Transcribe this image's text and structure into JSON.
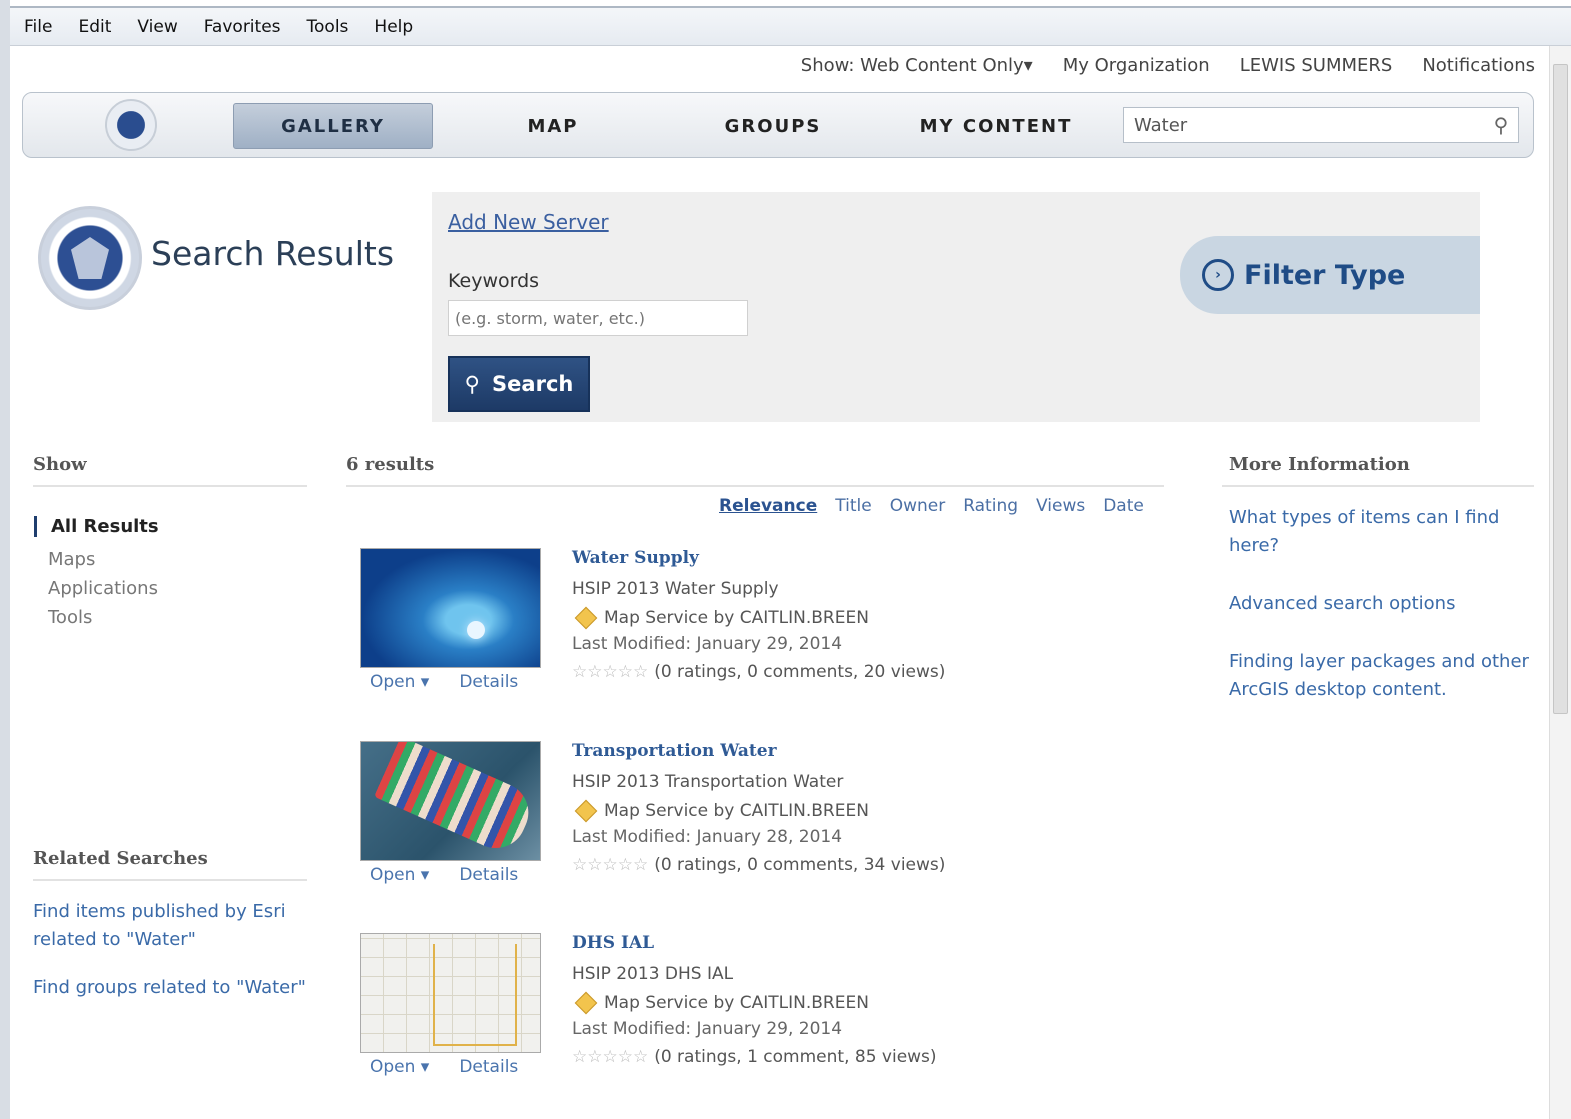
{
  "menu": [
    "File",
    "Edit",
    "View",
    "Favorites",
    "Tools",
    "Help"
  ],
  "toplinks": {
    "show": "Show: Web Content Only▾",
    "org": "My Organization",
    "user": "LEWIS SUMMERS",
    "notifications": "Notifications"
  },
  "nav": {
    "items": [
      "GALLERY",
      "MAP",
      "GROUPS",
      "MY CONTENT"
    ],
    "active": "GALLERY",
    "search_value": "Water"
  },
  "header": {
    "title": "Search Results",
    "add_server": "Add New Server",
    "keywords_label": "Keywords",
    "keywords_placeholder": "(e.g. storm, water, etc.)",
    "search_button": "Search",
    "filter_type": "Filter Type"
  },
  "left": {
    "show_heading": "Show",
    "show_items": [
      "All Results",
      "Maps",
      "Applications",
      "Tools"
    ],
    "related_heading": "Related Searches",
    "related_links": [
      "Find items published by Esri related to \"Water\"",
      "Find groups related to \"Water\""
    ]
  },
  "main": {
    "count": "6 results",
    "sort": [
      "Relevance",
      "Title",
      "Owner",
      "Rating",
      "Views",
      "Date"
    ],
    "open_label": "Open ▾",
    "details_label": "Details",
    "results": [
      {
        "title": "Water Supply",
        "desc": "HSIP 2013 Water Supply",
        "type": "Map Service by CAITLIN.BREEN",
        "modified": "Last Modified: January 29, 2014",
        "rating": "(0 ratings, 0 comments, 20 views)"
      },
      {
        "title": "Transportation Water",
        "desc": "HSIP 2013 Transportation Water",
        "type": "Map Service by CAITLIN.BREEN",
        "modified": "Last Modified: January 28, 2014",
        "rating": "(0 ratings, 0 comments, 34 views)"
      },
      {
        "title": "DHS IAL",
        "desc": "HSIP 2013 DHS IAL",
        "type": "Map Service by CAITLIN.BREEN",
        "modified": "Last Modified: January 29, 2014",
        "rating": "(0 ratings, 1 comment, 85 views)"
      }
    ]
  },
  "right": {
    "heading": "More Information",
    "links": [
      "What types of items can I find here?",
      "Advanced search options",
      "Finding layer packages and other ArcGIS desktop content."
    ]
  },
  "colors": {
    "link": "#3a6aa8",
    "button": "#1d3a66",
    "filter_bg": "#c9d6e2"
  }
}
